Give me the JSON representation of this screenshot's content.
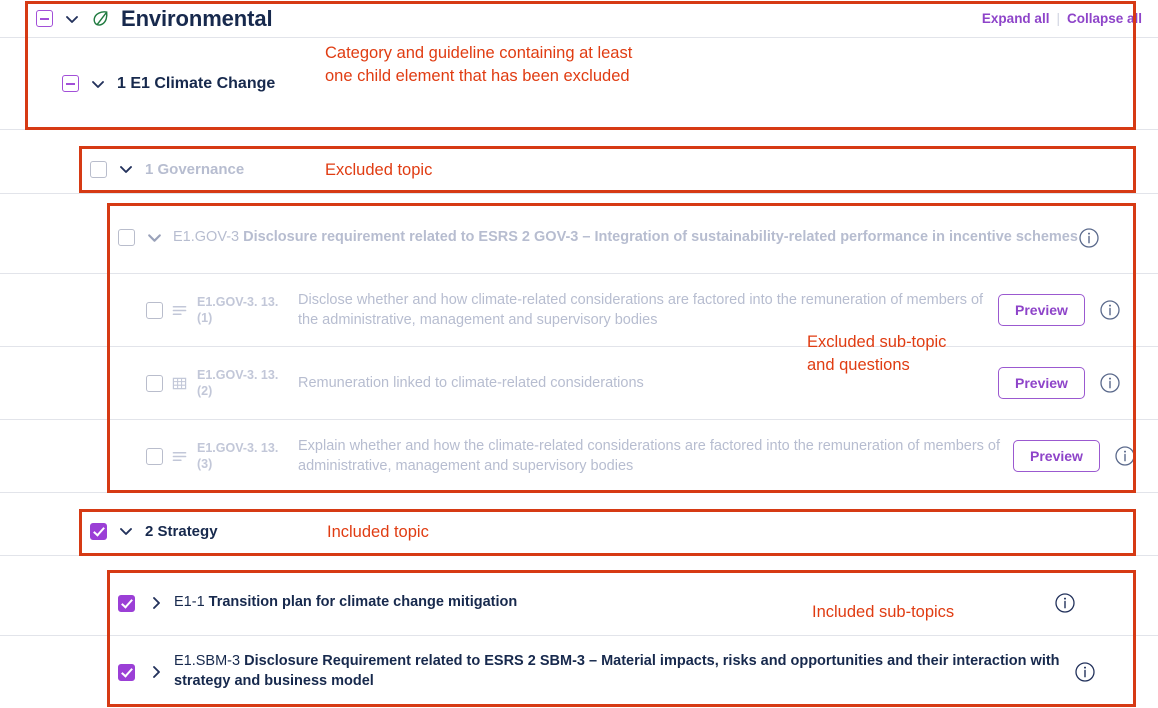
{
  "header": {
    "category": "Environmental",
    "leaf_icon": "leaf-icon",
    "expand_all": "Expand all",
    "collapse_all": "Collapse all",
    "separator": "|"
  },
  "guideline": {
    "title": "1 E1 Climate Change"
  },
  "topics": [
    {
      "id": "governance",
      "title": "1 Governance",
      "checked": false,
      "state": "excluded"
    },
    {
      "id": "strategy",
      "title": "2 Strategy",
      "checked": true,
      "state": "included"
    }
  ],
  "subtopics": [
    {
      "id": "e1-gov-3",
      "code": "E1.GOV-3",
      "title": "Disclosure requirement related to ESRS 2 GOV-3 – Integration of sustainability-related performance in incentive schemes",
      "checked": false,
      "state": "excluded",
      "expanded": true
    },
    {
      "id": "e1-1",
      "code": "E1-1",
      "title": "Transition plan for climate change mitigation",
      "checked": true,
      "state": "included",
      "expanded": false
    },
    {
      "id": "e1-sbm-3",
      "code": "E1.SBM-3",
      "title": "Disclosure Requirement related to ESRS 2 SBM-3 – Material impacts, risks and opportunities and their interaction with strategy and business model",
      "checked": true,
      "state": "included",
      "expanded": false
    }
  ],
  "questions": [
    {
      "code": "E1.GOV-3. 13. (1)",
      "icon": "text-lines-icon",
      "text": "Disclose whether and how climate-related considerations are factored into the remuneration of members of the administrative, management and supervisory bodies",
      "checked": false,
      "preview_label": "Preview"
    },
    {
      "code": "E1.GOV-3. 13. (2)",
      "icon": "table-grid-icon",
      "text": "Remuneration linked to climate-related considerations",
      "checked": false,
      "preview_label": "Preview"
    },
    {
      "code": "E1.GOV-3. 13. (3)",
      "icon": "text-lines-icon",
      "text": "Explain whether and how the climate-related considerations are factored into the remuneration of members of administrative, management and supervisory bodies",
      "checked": false,
      "preview_label": "Preview"
    }
  ],
  "annotations": [
    {
      "id": "category-guideline",
      "text": "Category and guideline containing at least\none child element that has been excluded"
    },
    {
      "id": "excluded-topic",
      "text": "Excluded topic"
    },
    {
      "id": "excluded-subtopic-questions",
      "text": "Excluded sub-topic\nand questions"
    },
    {
      "id": "included-topic",
      "text": "Included topic"
    },
    {
      "id": "included-subtopics",
      "text": "Included sub-topics"
    }
  ],
  "colors": {
    "accent_purple": "#8e44c9",
    "annotation_red": "#d63a14",
    "text_dark": "#17294d",
    "text_muted": "#b7bdd0",
    "leaf_green": "#1f7a3f"
  }
}
